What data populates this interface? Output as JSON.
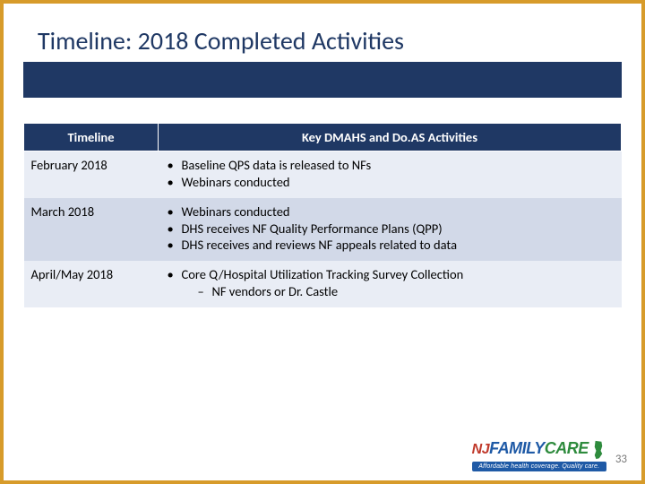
{
  "title": "Timeline: 2018 Completed Activities",
  "headers": {
    "col1": "Timeline",
    "col2": "Key DMAHS and Do.AS Activities"
  },
  "rows": [
    {
      "period": "February 2018",
      "items": [
        {
          "text": "Baseline QPS data is released to NFs"
        },
        {
          "text": "Webinars conducted"
        }
      ]
    },
    {
      "period": "March 2018",
      "items": [
        {
          "text": "Webinars conducted"
        },
        {
          "text": "DHS receives NF Quality Performance Plans (QPP)"
        },
        {
          "text": "DHS receives and reviews NF appeals related to data"
        }
      ]
    },
    {
      "period": "April/May 2018",
      "items": [
        {
          "text": "Core Q/Hospital Utilization Tracking Survey Collection",
          "sub": [
            "NF vendors or Dr. Castle"
          ]
        }
      ]
    }
  ],
  "logo": {
    "nj": "NJ",
    "family": "FAMILY",
    "care": "CARE",
    "tagline": "Affordable health coverage. Quality care."
  },
  "page_number": "33"
}
